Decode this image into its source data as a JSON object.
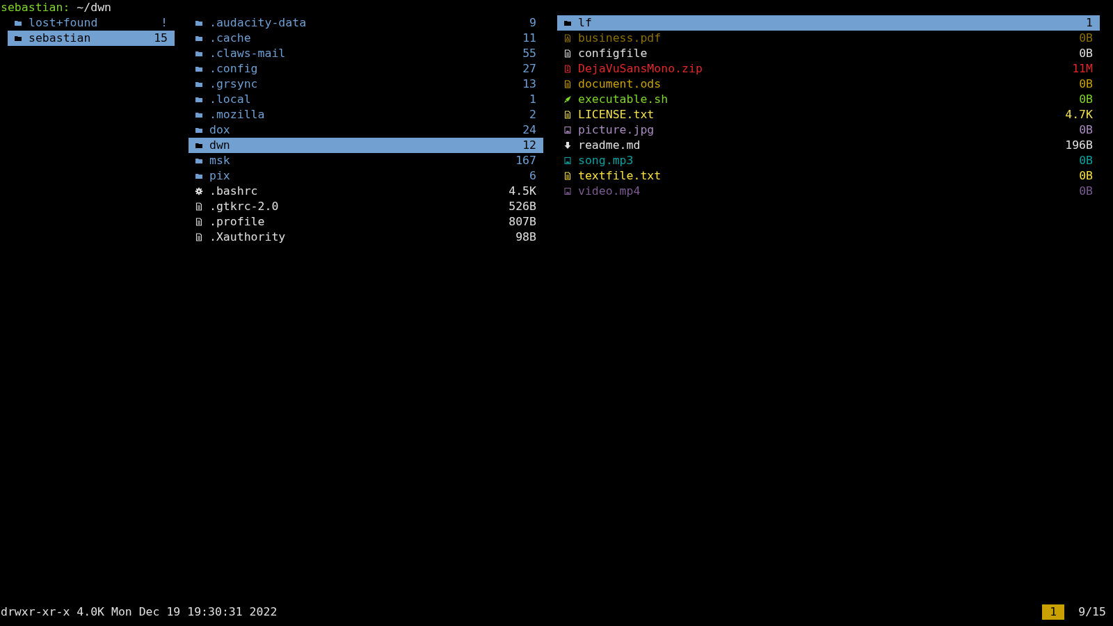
{
  "path_prompt": {
    "user": "sebastian:",
    "path": "~/dwn"
  },
  "panes": [
    {
      "items": [
        {
          "name": "lost+found",
          "size": "!",
          "kind": "folder",
          "color": "#6f9fd2",
          "selected": false
        },
        {
          "name": "sebastian",
          "size": "15",
          "kind": "folder",
          "selected": true
        }
      ]
    },
    {
      "items": [
        {
          "name": ".audacity-data",
          "size": "9",
          "kind": "folder",
          "color": "#6f9fd2",
          "selected": false
        },
        {
          "name": ".cache",
          "size": "11",
          "kind": "folder",
          "color": "#6f9fd2",
          "selected": false
        },
        {
          "name": ".claws-mail",
          "size": "55",
          "kind": "folder",
          "color": "#6f9fd2",
          "selected": false
        },
        {
          "name": ".config",
          "size": "27",
          "kind": "folder",
          "color": "#6f9fd2",
          "selected": false
        },
        {
          "name": ".grsync",
          "size": "13",
          "kind": "folder",
          "color": "#6f9fd2",
          "selected": false
        },
        {
          "name": ".local",
          "size": "1",
          "kind": "folder",
          "color": "#6f9fd2",
          "selected": false
        },
        {
          "name": ".mozilla",
          "size": "2",
          "kind": "folder",
          "color": "#6f9fd2",
          "selected": false
        },
        {
          "name": "dox",
          "size": "24",
          "kind": "folder",
          "color": "#6f9fd2",
          "selected": false
        },
        {
          "name": "dwn",
          "size": "12",
          "kind": "folder",
          "selected": true
        },
        {
          "name": "msk",
          "size": "167",
          "kind": "folder",
          "color": "#6f9fd2",
          "selected": false
        },
        {
          "name": "pix",
          "size": "6",
          "kind": "folder",
          "color": "#6f9fd2",
          "selected": false
        },
        {
          "name": ".bashrc",
          "size": "4.5K",
          "kind": "gear",
          "color": "#e0e0e0",
          "selected": false
        },
        {
          "name": ".gtkrc-2.0",
          "size": "526B",
          "kind": "text",
          "color": "#e0e0e0",
          "selected": false
        },
        {
          "name": ".profile",
          "size": "807B",
          "kind": "text",
          "color": "#e0e0e0",
          "selected": false
        },
        {
          "name": ".Xauthority",
          "size": "98B",
          "kind": "text",
          "color": "#e0e0e0",
          "selected": false
        }
      ]
    },
    {
      "items": [
        {
          "name": "lf",
          "size": "1",
          "kind": "folder",
          "selected": true
        },
        {
          "name": "business.pdf",
          "size": "0B",
          "kind": "pdf",
          "color": "#8a7000",
          "selected": false
        },
        {
          "name": "configfile",
          "size": "0B",
          "kind": "text",
          "color": "#e0e0e0",
          "selected": false
        },
        {
          "name": "DejaVuSansMono.zip",
          "size": "11M",
          "kind": "archive",
          "color": "#e0282a",
          "selected": false
        },
        {
          "name": "document.ods",
          "size": "0B",
          "kind": "text",
          "color": "#c8a000",
          "selected": false
        },
        {
          "name": "executable.sh",
          "size": "0B",
          "kind": "rocket",
          "color": "#7fd42a",
          "selected": false
        },
        {
          "name": "LICENSE.txt",
          "size": "4.7K",
          "kind": "text",
          "color": "#f0e050",
          "selected": false
        },
        {
          "name": "picture.jpg",
          "size": "0B",
          "kind": "image",
          "color": "#a98cc0",
          "selected": false
        },
        {
          "name": "readme.md",
          "size": "196B",
          "kind": "arrow",
          "color": "#e0e0e0",
          "selected": false
        },
        {
          "name": "song.mp3",
          "size": "0B",
          "kind": "image",
          "color": "#0aa0a0",
          "selected": false
        },
        {
          "name": "textfile.txt",
          "size": "0B",
          "kind": "text",
          "color": "#f8e040",
          "selected": false
        },
        {
          "name": "video.mp4",
          "size": "0B",
          "kind": "image",
          "color": "#7a5a90",
          "selected": false
        }
      ]
    }
  ],
  "status_bar": {
    "info": "drwxr-xr-x 4.0K Mon Dec 19 19:30:31 2022",
    "badge": "1",
    "position": "9/15"
  }
}
